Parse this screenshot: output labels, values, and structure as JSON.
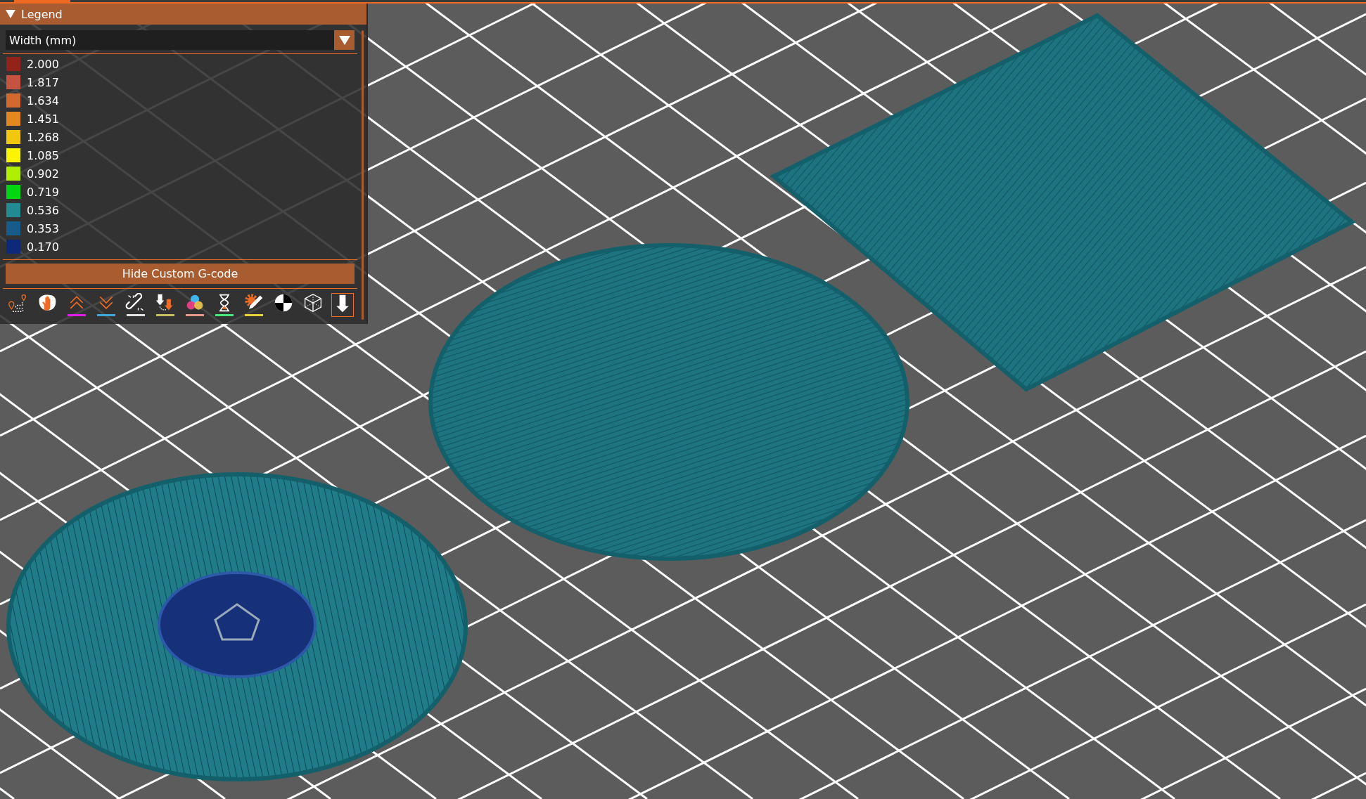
{
  "legend": {
    "title": "Legend",
    "expanded": true,
    "view_type": "Width (mm)",
    "items": [
      {
        "value": "2.000",
        "color": "#92231a"
      },
      {
        "value": "1.817",
        "color": "#c4533f"
      },
      {
        "value": "1.634",
        "color": "#d2692f"
      },
      {
        "value": "1.451",
        "color": "#e3871f"
      },
      {
        "value": "1.268",
        "color": "#f2c80e"
      },
      {
        "value": "1.085",
        "color": "#fbf500"
      },
      {
        "value": "0.902",
        "color": "#aef000"
      },
      {
        "value": "0.719",
        "color": "#02d811"
      },
      {
        "value": "0.536",
        "color": "#218a93"
      },
      {
        "value": "0.353",
        "color": "#175b88"
      },
      {
        "value": "0.170",
        "color": "#0c2a78"
      }
    ],
    "button": "Hide Custom G-code",
    "toolbar": [
      {
        "kind": "travel",
        "selected": false
      },
      {
        "kind": "wipe",
        "selected": false
      },
      {
        "kind": "retractions",
        "selected": false,
        "color": "#e01de8"
      },
      {
        "kind": "deretractions",
        "selected": false,
        "color": "#3fa6d9"
      },
      {
        "kind": "seams",
        "selected": false,
        "color": "#e4e4e4"
      },
      {
        "kind": "toolchanges",
        "selected": false,
        "color": "#c8c060"
      },
      {
        "kind": "colorchanges",
        "selected": false,
        "color": "#e69a8c"
      },
      {
        "kind": "pause",
        "selected": false,
        "color": "#48e87a"
      },
      {
        "kind": "customgcode",
        "selected": false,
        "color": "#e8d23a"
      },
      {
        "kind": "cog",
        "selected": false
      },
      {
        "kind": "shells",
        "selected": false
      },
      {
        "kind": "toolmarker",
        "selected": true
      }
    ]
  }
}
